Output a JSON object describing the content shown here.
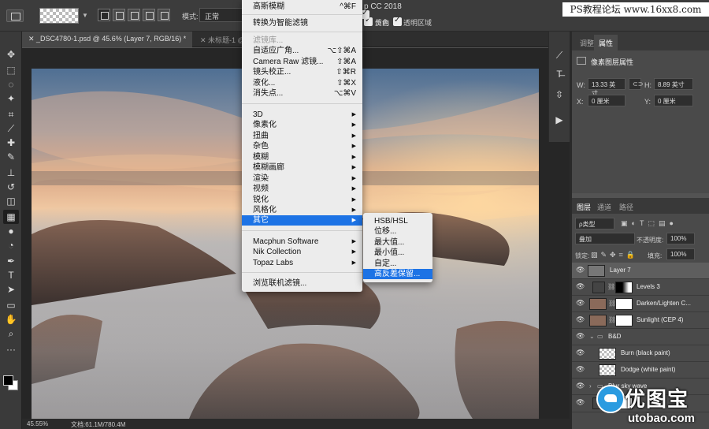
{
  "options_bar": {
    "mode_label": "模式:",
    "mode_value": "正常",
    "reverse_label": "反向",
    "dither_label": "仿色",
    "transparency_label": "透明区域"
  },
  "app_title_fragment": "p CC 2018",
  "watermark_top": "PS教程论坛 www.16xx8.com",
  "watermark_logo": {
    "cn": "优图宝",
    "url": "utobao.com"
  },
  "tabs": [
    {
      "label": "_DSC4780-1.psd @ 45.6% (Layer 7, RGB/16) *"
    },
    {
      "label": "未标题-1 @"
    }
  ],
  "status": {
    "zoom": "45.55%",
    "doc": "文档:61.1M/780.4M"
  },
  "filter_menu": {
    "items": [
      {
        "label": "高斯模糊",
        "shortcut": "^⌘F"
      },
      {
        "label": "转换为智能滤镜"
      },
      {
        "label": "滤镜库...",
        "disabled": true
      },
      {
        "label": "自适应广角...",
        "shortcut": "⌥⇧⌘A"
      },
      {
        "label": "Camera Raw 滤镜...",
        "shortcut": "⇧⌘A"
      },
      {
        "label": "镜头校正...",
        "shortcut": "⇧⌘R"
      },
      {
        "label": "液化...",
        "shortcut": "⇧⌘X"
      },
      {
        "label": "消失点...",
        "shortcut": "⌥⌘V"
      },
      {
        "label": "3D"
      },
      {
        "label": "像素化"
      },
      {
        "label": "扭曲"
      },
      {
        "label": "杂色"
      },
      {
        "label": "模糊"
      },
      {
        "label": "模糊画廊"
      },
      {
        "label": "渲染"
      },
      {
        "label": "视频"
      },
      {
        "label": "锐化"
      },
      {
        "label": "风格化"
      },
      {
        "label": "其它"
      },
      {
        "label": "Macphun Software"
      },
      {
        "label": "Nik Collection"
      },
      {
        "label": "Topaz Labs"
      },
      {
        "label": "浏览联机滤镜..."
      }
    ]
  },
  "submenu": {
    "items": [
      {
        "label": "HSB/HSL"
      },
      {
        "label": "位移..."
      },
      {
        "label": "最大值..."
      },
      {
        "label": "最小值..."
      },
      {
        "label": "自定..."
      },
      {
        "label": "高反差保留..."
      }
    ]
  },
  "properties": {
    "tab_adjust": "调整",
    "tab_props": "属性",
    "title": "像素图层属性",
    "w_label": "W:",
    "w_value": "13.33 英寸",
    "h_label": "H:",
    "h_value": "8.89 英寸",
    "x_label": "X:",
    "x_value": "0 厘米",
    "y_label": "Y:",
    "y_value": "0 厘米"
  },
  "layers": {
    "tab_layers": "图层",
    "tab_channels": "通道",
    "tab_paths": "路径",
    "kind_label": "ρ类型",
    "blend_mode": "叠加",
    "opacity_label": "不透明度:",
    "opacity_value": "100%",
    "lock_label": "锁定:",
    "fill_label": "填充:",
    "fill_value": "100%",
    "rows": [
      {
        "name": "Layer 7"
      },
      {
        "name": "Levels 3"
      },
      {
        "name": "Darken/Lighten C..."
      },
      {
        "name": "Sunlight (CEP 4)"
      },
      {
        "name": "B&D"
      },
      {
        "name": "Burn (black paint)"
      },
      {
        "name": "Dodge (white paint)"
      },
      {
        "name": "Blur sky wave"
      }
    ]
  }
}
